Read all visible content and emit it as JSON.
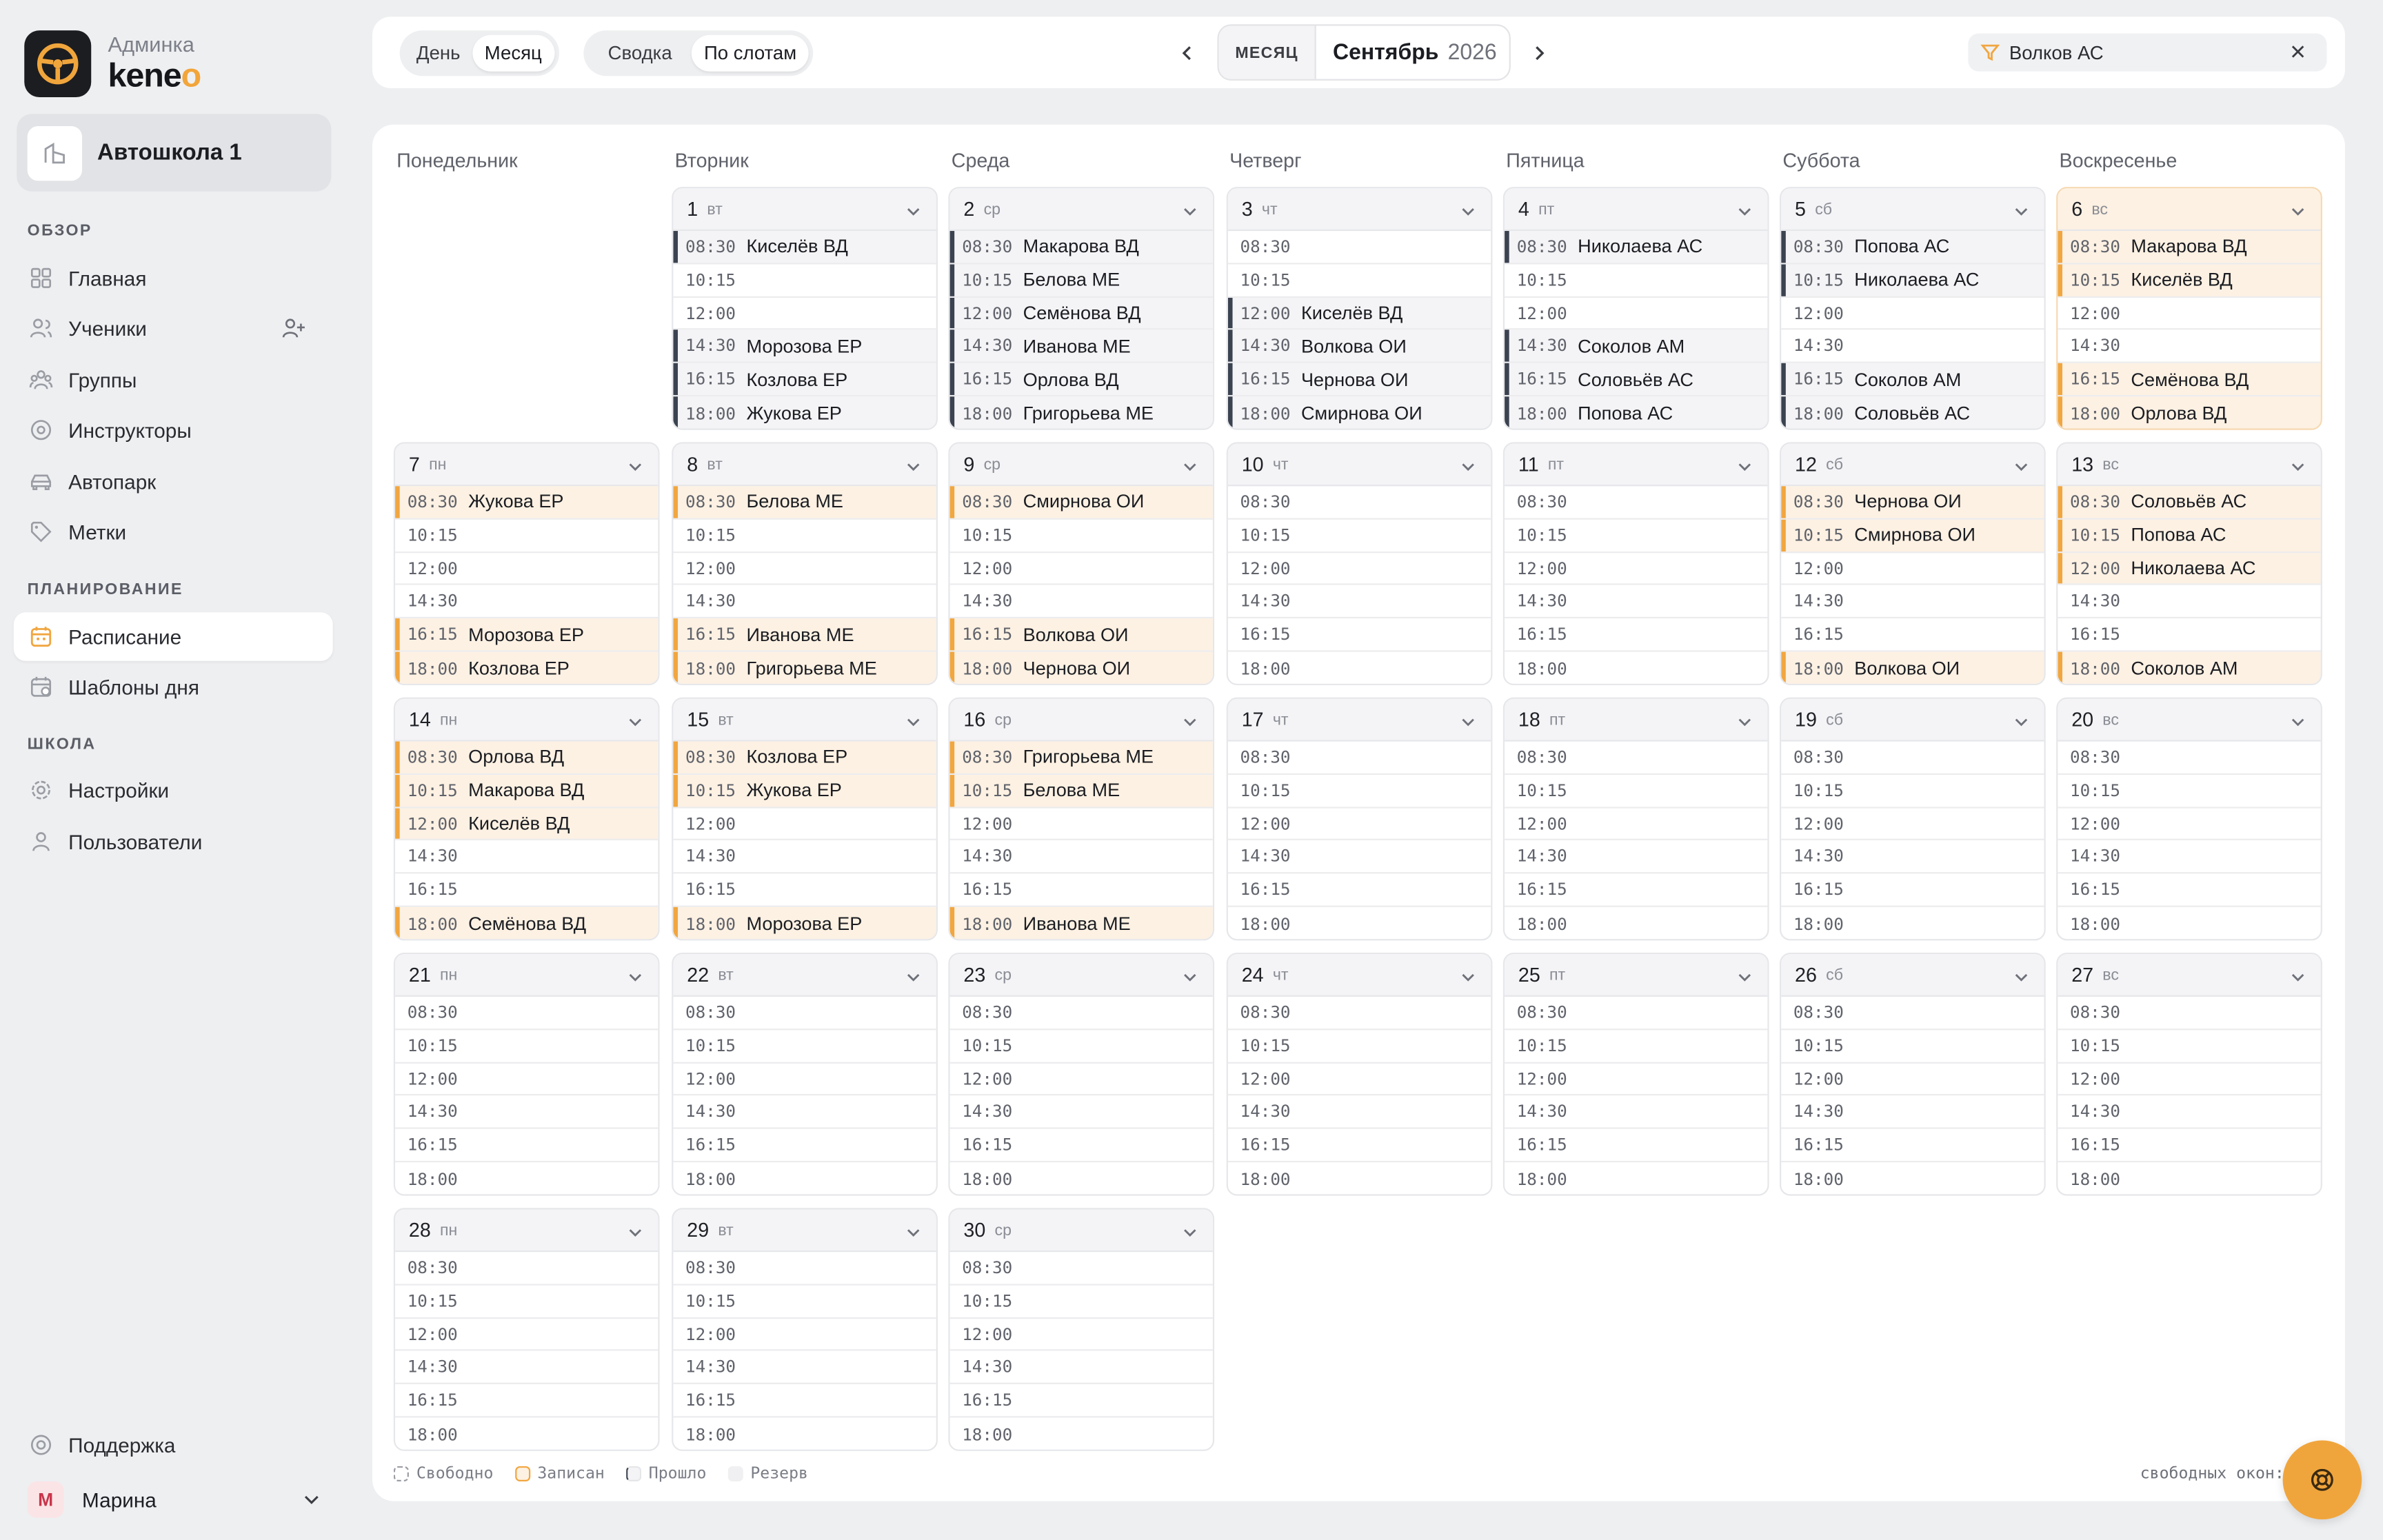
{
  "app": {
    "sub": "Админка",
    "name_main": "kene",
    "name_accent": "o"
  },
  "school": {
    "name": "Автошкола 1"
  },
  "sidebar": {
    "sections": [
      "ОБЗОР",
      "ПЛАНИРОВАНИЕ",
      "ШКОЛА"
    ],
    "items": [
      {
        "label": "Главная",
        "icon": "home-icon"
      },
      {
        "label": "Ученики",
        "icon": "users-icon"
      },
      {
        "label": "Группы",
        "icon": "groups-icon"
      },
      {
        "label": "Инструкторы",
        "icon": "instructor-icon"
      },
      {
        "label": "Автопарк",
        "icon": "car-icon"
      },
      {
        "label": "Метки",
        "icon": "tag-icon"
      },
      {
        "label": "Расписание",
        "icon": "calendar-icon",
        "active": true
      },
      {
        "label": "Шаблоны дня",
        "icon": "template-icon"
      },
      {
        "label": "Настройки",
        "icon": "gear-icon"
      },
      {
        "label": "Пользователи",
        "icon": "user-icon"
      }
    ],
    "support": "Поддержка",
    "user": {
      "initial": "М",
      "name": "Марина"
    }
  },
  "toolbar": {
    "view_tabs": [
      {
        "label": "День"
      },
      {
        "label": "Месяц",
        "active": true
      }
    ],
    "mode_tabs": [
      {
        "label": "Сводка"
      },
      {
        "label": "По слотам",
        "active": true
      }
    ],
    "period_mode": "МЕСЯЦ",
    "month": "Сентябрь",
    "year": "2026",
    "filter_value": "Волков АС"
  },
  "weekdays": [
    "Понедельник",
    "Вторник",
    "Среда",
    "Четверг",
    "Пятница",
    "Суббота",
    "Воскресенье"
  ],
  "slot_times": [
    "08:30",
    "10:15",
    "12:00",
    "14:30",
    "16:15",
    "18:00"
  ],
  "days": [
    {
      "num": "1",
      "wd": "вт",
      "col": 1,
      "row": 0,
      "slots": [
        {
          "s": "past",
          "n": "Киселёв ВД"
        },
        {
          "s": "free",
          "n": ""
        },
        {
          "s": "free",
          "n": ""
        },
        {
          "s": "past",
          "n": "Морозова ЕР"
        },
        {
          "s": "past",
          "n": "Козлова ЕР"
        },
        {
          "s": "past",
          "n": "Жукова ЕР"
        }
      ]
    },
    {
      "num": "2",
      "wd": "ср",
      "col": 2,
      "row": 0,
      "slots": [
        {
          "s": "past",
          "n": "Макарова ВД"
        },
        {
          "s": "past",
          "n": "Белова МЕ"
        },
        {
          "s": "past",
          "n": "Семёнова ВД"
        },
        {
          "s": "past",
          "n": "Иванова МЕ"
        },
        {
          "s": "past",
          "n": "Орлова ВД"
        },
        {
          "s": "past",
          "n": "Григорьева МЕ"
        }
      ]
    },
    {
      "num": "3",
      "wd": "чт",
      "col": 3,
      "row": 0,
      "slots": [
        {
          "s": "free",
          "n": ""
        },
        {
          "s": "free",
          "n": ""
        },
        {
          "s": "past",
          "n": "Киселёв ВД"
        },
        {
          "s": "past",
          "n": "Волкова ОИ"
        },
        {
          "s": "past",
          "n": "Чернова ОИ"
        },
        {
          "s": "past",
          "n": "Смирнова ОИ"
        }
      ]
    },
    {
      "num": "4",
      "wd": "пт",
      "col": 4,
      "row": 0,
      "slots": [
        {
          "s": "past",
          "n": "Николаева АС"
        },
        {
          "s": "free",
          "n": ""
        },
        {
          "s": "free",
          "n": ""
        },
        {
          "s": "past",
          "n": "Соколов АМ"
        },
        {
          "s": "past",
          "n": "Соловьёв АС"
        },
        {
          "s": "past",
          "n": "Попова АС"
        }
      ]
    },
    {
      "num": "5",
      "wd": "сб",
      "col": 5,
      "row": 0,
      "slots": [
        {
          "s": "past",
          "n": "Попова АС"
        },
        {
          "s": "past",
          "n": "Николаева АС"
        },
        {
          "s": "free",
          "n": ""
        },
        {
          "s": "free",
          "n": ""
        },
        {
          "s": "past",
          "n": "Соколов АМ"
        },
        {
          "s": "past",
          "n": "Соловьёв АС"
        }
      ]
    },
    {
      "num": "6",
      "wd": "вс",
      "col": 6,
      "row": 0,
      "today": true,
      "slots": [
        {
          "s": "booked",
          "n": "Макарова ВД"
        },
        {
          "s": "booked",
          "n": "Киселёв ВД"
        },
        {
          "s": "free",
          "n": ""
        },
        {
          "s": "free",
          "n": ""
        },
        {
          "s": "booked",
          "n": "Семёнова ВД"
        },
        {
          "s": "booked",
          "n": "Орлова ВД"
        }
      ]
    },
    {
      "num": "7",
      "wd": "пн",
      "col": 0,
      "row": 1,
      "slots": [
        {
          "s": "booked",
          "n": "Жукова ЕР"
        },
        {
          "s": "free",
          "n": ""
        },
        {
          "s": "free",
          "n": ""
        },
        {
          "s": "free",
          "n": ""
        },
        {
          "s": "booked",
          "n": "Морозова ЕР"
        },
        {
          "s": "booked",
          "n": "Козлова ЕР"
        }
      ]
    },
    {
      "num": "8",
      "wd": "вт",
      "col": 1,
      "row": 1,
      "slots": [
        {
          "s": "booked",
          "n": "Белова МЕ"
        },
        {
          "s": "free",
          "n": ""
        },
        {
          "s": "free",
          "n": ""
        },
        {
          "s": "free",
          "n": ""
        },
        {
          "s": "booked",
          "n": "Иванова МЕ"
        },
        {
          "s": "booked",
          "n": "Григорьева МЕ"
        }
      ]
    },
    {
      "num": "9",
      "wd": "ср",
      "col": 2,
      "row": 1,
      "slots": [
        {
          "s": "booked",
          "n": "Смирнова ОИ"
        },
        {
          "s": "free",
          "n": ""
        },
        {
          "s": "free",
          "n": ""
        },
        {
          "s": "free",
          "n": ""
        },
        {
          "s": "booked",
          "n": "Волкова ОИ"
        },
        {
          "s": "booked",
          "n": "Чернова ОИ"
        }
      ]
    },
    {
      "num": "10",
      "wd": "чт",
      "col": 3,
      "row": 1,
      "slots": [
        {
          "s": "free",
          "n": ""
        },
        {
          "s": "free",
          "n": ""
        },
        {
          "s": "free",
          "n": ""
        },
        {
          "s": "free",
          "n": ""
        },
        {
          "s": "free",
          "n": ""
        },
        {
          "s": "free",
          "n": ""
        }
      ]
    },
    {
      "num": "11",
      "wd": "пт",
      "col": 4,
      "row": 1,
      "slots": [
        {
          "s": "free",
          "n": ""
        },
        {
          "s": "free",
          "n": ""
        },
        {
          "s": "free",
          "n": ""
        },
        {
          "s": "free",
          "n": ""
        },
        {
          "s": "free",
          "n": ""
        },
        {
          "s": "free",
          "n": ""
        }
      ]
    },
    {
      "num": "12",
      "wd": "сб",
      "col": 5,
      "row": 1,
      "slots": [
        {
          "s": "booked",
          "n": "Чернова ОИ"
        },
        {
          "s": "booked",
          "n": "Смирнова ОИ"
        },
        {
          "s": "free",
          "n": ""
        },
        {
          "s": "free",
          "n": ""
        },
        {
          "s": "free",
          "n": ""
        },
        {
          "s": "booked",
          "n": "Волкова ОИ"
        }
      ]
    },
    {
      "num": "13",
      "wd": "вс",
      "col": 6,
      "row": 1,
      "slots": [
        {
          "s": "booked",
          "n": "Соловьёв АС"
        },
        {
          "s": "booked",
          "n": "Попова АС"
        },
        {
          "s": "booked",
          "n": "Николаева АС"
        },
        {
          "s": "free",
          "n": ""
        },
        {
          "s": "free",
          "n": ""
        },
        {
          "s": "booked",
          "n": "Соколов АМ"
        }
      ]
    },
    {
      "num": "14",
      "wd": "пн",
      "col": 0,
      "row": 2,
      "slots": [
        {
          "s": "booked",
          "n": "Орлова ВД"
        },
        {
          "s": "booked",
          "n": "Макарова ВД"
        },
        {
          "s": "booked",
          "n": "Киселёв ВД"
        },
        {
          "s": "free",
          "n": ""
        },
        {
          "s": "free",
          "n": ""
        },
        {
          "s": "booked",
          "n": "Семёнова ВД"
        }
      ]
    },
    {
      "num": "15",
      "wd": "вт",
      "col": 1,
      "row": 2,
      "slots": [
        {
          "s": "booked",
          "n": "Козлова ЕР"
        },
        {
          "s": "booked",
          "n": "Жукова ЕР"
        },
        {
          "s": "free",
          "n": ""
        },
        {
          "s": "free",
          "n": ""
        },
        {
          "s": "free",
          "n": ""
        },
        {
          "s": "booked",
          "n": "Морозова ЕР"
        }
      ]
    },
    {
      "num": "16",
      "wd": "ср",
      "col": 2,
      "row": 2,
      "slots": [
        {
          "s": "booked",
          "n": "Григорьева МЕ"
        },
        {
          "s": "booked",
          "n": "Белова МЕ"
        },
        {
          "s": "free",
          "n": ""
        },
        {
          "s": "free",
          "n": ""
        },
        {
          "s": "free",
          "n": ""
        },
        {
          "s": "booked",
          "n": "Иванова МЕ"
        }
      ]
    },
    {
      "num": "17",
      "wd": "чт",
      "col": 3,
      "row": 2,
      "slots": [
        {
          "s": "free",
          "n": ""
        },
        {
          "s": "free",
          "n": ""
        },
        {
          "s": "free",
          "n": ""
        },
        {
          "s": "free",
          "n": ""
        },
        {
          "s": "free",
          "n": ""
        },
        {
          "s": "free",
          "n": ""
        }
      ]
    },
    {
      "num": "18",
      "wd": "пт",
      "col": 4,
      "row": 2,
      "slots": [
        {
          "s": "free",
          "n": ""
        },
        {
          "s": "free",
          "n": ""
        },
        {
          "s": "free",
          "n": ""
        },
        {
          "s": "free",
          "n": ""
        },
        {
          "s": "free",
          "n": ""
        },
        {
          "s": "free",
          "n": ""
        }
      ]
    },
    {
      "num": "19",
      "wd": "сб",
      "col": 5,
      "row": 2,
      "slots": [
        {
          "s": "free",
          "n": ""
        },
        {
          "s": "free",
          "n": ""
        },
        {
          "s": "free",
          "n": ""
        },
        {
          "s": "free",
          "n": ""
        },
        {
          "s": "free",
          "n": ""
        },
        {
          "s": "free",
          "n": ""
        }
      ]
    },
    {
      "num": "20",
      "wd": "вс",
      "col": 6,
      "row": 2,
      "slots": [
        {
          "s": "free",
          "n": ""
        },
        {
          "s": "free",
          "n": ""
        },
        {
          "s": "free",
          "n": ""
        },
        {
          "s": "free",
          "n": ""
        },
        {
          "s": "free",
          "n": ""
        },
        {
          "s": "free",
          "n": ""
        }
      ]
    },
    {
      "num": "21",
      "wd": "пн",
      "col": 0,
      "row": 3,
      "slots": [
        {
          "s": "free",
          "n": ""
        },
        {
          "s": "free",
          "n": ""
        },
        {
          "s": "free",
          "n": ""
        },
        {
          "s": "free",
          "n": ""
        },
        {
          "s": "free",
          "n": ""
        },
        {
          "s": "free",
          "n": ""
        }
      ]
    },
    {
      "num": "22",
      "wd": "вт",
      "col": 1,
      "row": 3,
      "slots": [
        {
          "s": "free",
          "n": ""
        },
        {
          "s": "free",
          "n": ""
        },
        {
          "s": "free",
          "n": ""
        },
        {
          "s": "free",
          "n": ""
        },
        {
          "s": "free",
          "n": ""
        },
        {
          "s": "free",
          "n": ""
        }
      ]
    },
    {
      "num": "23",
      "wd": "ср",
      "col": 2,
      "row": 3,
      "slots": [
        {
          "s": "free",
          "n": ""
        },
        {
          "s": "free",
          "n": ""
        },
        {
          "s": "free",
          "n": ""
        },
        {
          "s": "free",
          "n": ""
        },
        {
          "s": "free",
          "n": ""
        },
        {
          "s": "free",
          "n": ""
        }
      ]
    },
    {
      "num": "24",
      "wd": "чт",
      "col": 3,
      "row": 3,
      "slots": [
        {
          "s": "free",
          "n": ""
        },
        {
          "s": "free",
          "n": ""
        },
        {
          "s": "free",
          "n": ""
        },
        {
          "s": "free",
          "n": ""
        },
        {
          "s": "free",
          "n": ""
        },
        {
          "s": "free",
          "n": ""
        }
      ]
    },
    {
      "num": "25",
      "wd": "пт",
      "col": 4,
      "row": 3,
      "slots": [
        {
          "s": "free",
          "n": ""
        },
        {
          "s": "free",
          "n": ""
        },
        {
          "s": "free",
          "n": ""
        },
        {
          "s": "free",
          "n": ""
        },
        {
          "s": "free",
          "n": ""
        },
        {
          "s": "free",
          "n": ""
        }
      ]
    },
    {
      "num": "26",
      "wd": "сб",
      "col": 5,
      "row": 3,
      "slots": [
        {
          "s": "free",
          "n": ""
        },
        {
          "s": "free",
          "n": ""
        },
        {
          "s": "free",
          "n": ""
        },
        {
          "s": "free",
          "n": ""
        },
        {
          "s": "free",
          "n": ""
        },
        {
          "s": "free",
          "n": ""
        }
      ]
    },
    {
      "num": "27",
      "wd": "вс",
      "col": 6,
      "row": 3,
      "slots": [
        {
          "s": "free",
          "n": ""
        },
        {
          "s": "free",
          "n": ""
        },
        {
          "s": "free",
          "n": ""
        },
        {
          "s": "free",
          "n": ""
        },
        {
          "s": "free",
          "n": ""
        },
        {
          "s": "free",
          "n": ""
        }
      ]
    },
    {
      "num": "28",
      "wd": "пн",
      "col": 0,
      "row": 4,
      "slots": [
        {
          "s": "free",
          "n": ""
        },
        {
          "s": "free",
          "n": ""
        },
        {
          "s": "free",
          "n": ""
        },
        {
          "s": "free",
          "n": ""
        },
        {
          "s": "free",
          "n": ""
        },
        {
          "s": "free",
          "n": ""
        }
      ]
    },
    {
      "num": "29",
      "wd": "вт",
      "col": 1,
      "row": 4,
      "slots": [
        {
          "s": "free",
          "n": ""
        },
        {
          "s": "free",
          "n": ""
        },
        {
          "s": "free",
          "n": ""
        },
        {
          "s": "free",
          "n": ""
        },
        {
          "s": "free",
          "n": ""
        },
        {
          "s": "free",
          "n": ""
        }
      ]
    },
    {
      "num": "30",
      "wd": "ср",
      "col": 2,
      "row": 4,
      "slots": [
        {
          "s": "free",
          "n": ""
        },
        {
          "s": "free",
          "n": ""
        },
        {
          "s": "free",
          "n": ""
        },
        {
          "s": "free",
          "n": ""
        },
        {
          "s": "free",
          "n": ""
        },
        {
          "s": "free",
          "n": ""
        }
      ]
    }
  ],
  "legend": [
    {
      "label": "Свободно",
      "kind": "free"
    },
    {
      "label": "Записан",
      "kind": "booked"
    },
    {
      "label": "Прошло",
      "kind": "past"
    },
    {
      "label": "Резерв",
      "kind": "reserve"
    }
  ],
  "free_slots_label": "свободных окон:",
  "colors": {
    "accent": "#f1a640",
    "booked_bg": "#fdf1e3",
    "past_bar": "#3b4250",
    "page_bg": "#eeeff1"
  }
}
